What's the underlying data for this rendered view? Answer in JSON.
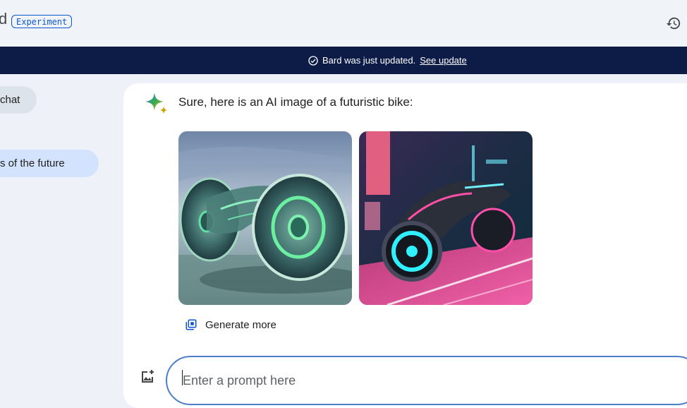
{
  "header": {
    "brand_tail": "d",
    "badge": "Experiment",
    "history_icon": "history-icon"
  },
  "banner": {
    "message": "Bard was just updated.",
    "link": "See update",
    "icon": "check-circle-icon"
  },
  "sidebar": {
    "new_chat": "chat",
    "recent_item": "s of the future"
  },
  "response": {
    "text": "Sure, here is an AI image of a futuristic bike:",
    "images": [
      {
        "name": "ai-image-bike-1"
      },
      {
        "name": "ai-image-bike-2"
      }
    ],
    "generate_more": "Generate more"
  },
  "input": {
    "placeholder": "Enter a prompt here"
  },
  "colors": {
    "banner_bg": "#0c1c47",
    "accent": "#0b57d0",
    "chip_selected": "#d3e3fd"
  }
}
